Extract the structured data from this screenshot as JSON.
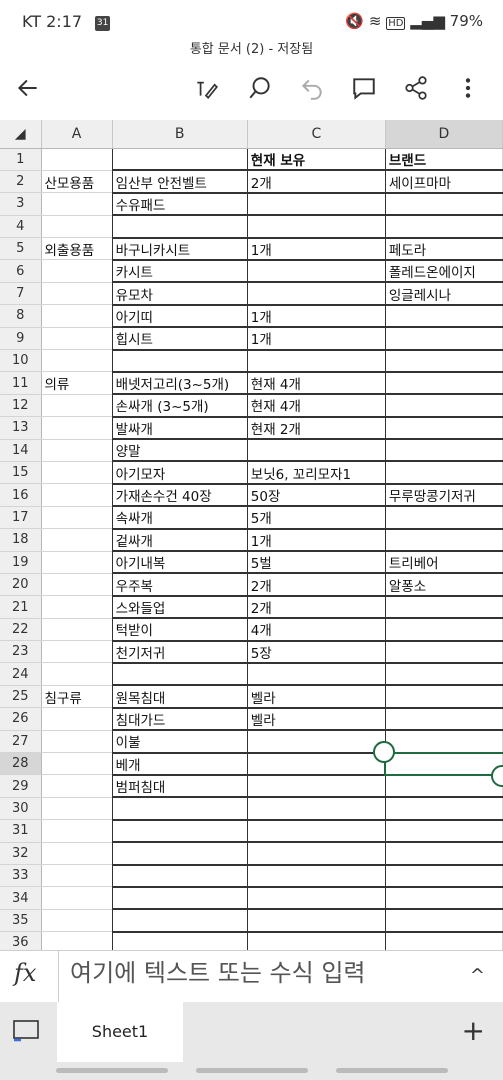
{
  "status_bar": {
    "carrier": "KT",
    "time": "2:17",
    "calendar_date": "31",
    "signal": "HD",
    "battery": "79%"
  },
  "doc": {
    "title": "통합 문서 (2) - 저장됨"
  },
  "toolbar": {
    "back": "back-arrow-icon",
    "icons": [
      "draw-icon",
      "search-icon",
      "undo-icon",
      "comment-icon",
      "share-icon",
      "more-icon"
    ]
  },
  "sheet": {
    "columns": [
      "A",
      "B",
      "C",
      "D"
    ],
    "selected_column": "D",
    "selected_row": 28,
    "rows": [
      {
        "n": "1",
        "a": "",
        "b": "",
        "c": "현재 보유",
        "d": "브랜드"
      },
      {
        "n": "2",
        "a": "산모용품",
        "b": "임산부 안전벨트",
        "c": "2개",
        "d": "세이프마마"
      },
      {
        "n": "3",
        "a": "",
        "b": "수유패드",
        "c": "",
        "d": ""
      },
      {
        "n": "4",
        "a": "",
        "b": "",
        "c": "",
        "d": ""
      },
      {
        "n": "5",
        "a": "외출용품",
        "b": "바구니카시트",
        "c": "1개",
        "d": "페도라"
      },
      {
        "n": "6",
        "a": "",
        "b": "카시트",
        "c": "",
        "d": "폴레드온에이지"
      },
      {
        "n": "7",
        "a": "",
        "b": "유모차",
        "c": "",
        "d": "잉글레시나"
      },
      {
        "n": "8",
        "a": "",
        "b": "아기띠",
        "c": "1개",
        "d": ""
      },
      {
        "n": "9",
        "a": "",
        "b": "힙시트",
        "c": "1개",
        "d": ""
      },
      {
        "n": "10",
        "a": "",
        "b": "",
        "c": "",
        "d": ""
      },
      {
        "n": "11",
        "a": "의류",
        "b": "배넷저고리(3~5개)",
        "c": "현재 4개",
        "d": ""
      },
      {
        "n": "12",
        "a": "",
        "b": "손싸개 (3~5개)",
        "c": "현재 4개",
        "d": ""
      },
      {
        "n": "13",
        "a": "",
        "b": "발싸개",
        "c": "현재 2개",
        "d": ""
      },
      {
        "n": "14",
        "a": "",
        "b": "양말",
        "c": "",
        "d": ""
      },
      {
        "n": "15",
        "a": "",
        "b": "아기모자",
        "c": "보닛6, 꼬리모자1",
        "d": ""
      },
      {
        "n": "16",
        "a": "",
        "b": "가재손수건 40장",
        "c": "50장",
        "d": "무루땅콩기저귀"
      },
      {
        "n": "17",
        "a": "",
        "b": "속싸개",
        "c": "5개",
        "d": ""
      },
      {
        "n": "18",
        "a": "",
        "b": "겉싸개",
        "c": "1개",
        "d": ""
      },
      {
        "n": "19",
        "a": "",
        "b": "아기내복",
        "c": "5벌",
        "d": "트리베어"
      },
      {
        "n": "20",
        "a": "",
        "b": "우주복",
        "c": "2개",
        "d": "알퐁소"
      },
      {
        "n": "21",
        "a": "",
        "b": "스와들업",
        "c": "2개",
        "d": ""
      },
      {
        "n": "22",
        "a": "",
        "b": "턱받이",
        "c": "4개",
        "d": ""
      },
      {
        "n": "23",
        "a": "",
        "b": "천기저귀",
        "c": "5장",
        "d": ""
      },
      {
        "n": "24",
        "a": "",
        "b": "",
        "c": "",
        "d": ""
      },
      {
        "n": "25",
        "a": "침구류",
        "b": "원목침대",
        "c": "벨라",
        "d": ""
      },
      {
        "n": "26",
        "a": "",
        "b": "침대가드",
        "c": "벨라",
        "d": ""
      },
      {
        "n": "27",
        "a": "",
        "b": "이불",
        "c": "",
        "d": ""
      },
      {
        "n": "28",
        "a": "",
        "b": "베개",
        "c": "",
        "d": ""
      },
      {
        "n": "29",
        "a": "",
        "b": "범퍼침대",
        "c": "",
        "d": ""
      },
      {
        "n": "30",
        "a": "",
        "b": "",
        "c": "",
        "d": ""
      },
      {
        "n": "31",
        "a": "",
        "b": "",
        "c": "",
        "d": ""
      },
      {
        "n": "32",
        "a": "",
        "b": "",
        "c": "",
        "d": ""
      },
      {
        "n": "33",
        "a": "",
        "b": "",
        "c": "",
        "d": ""
      },
      {
        "n": "34",
        "a": "",
        "b": "",
        "c": "",
        "d": ""
      },
      {
        "n": "35",
        "a": "",
        "b": "",
        "c": "",
        "d": ""
      },
      {
        "n": "36",
        "a": "",
        "b": "",
        "c": "",
        "d": ""
      }
    ]
  },
  "formula_bar": {
    "fx": "fx",
    "placeholder": "여기에 텍스트 또는 수식 입력",
    "expand": "^"
  },
  "sheet_tabs": {
    "active": "Sheet1",
    "add": "+"
  },
  "colors": {
    "accent": "#1e6b42"
  }
}
